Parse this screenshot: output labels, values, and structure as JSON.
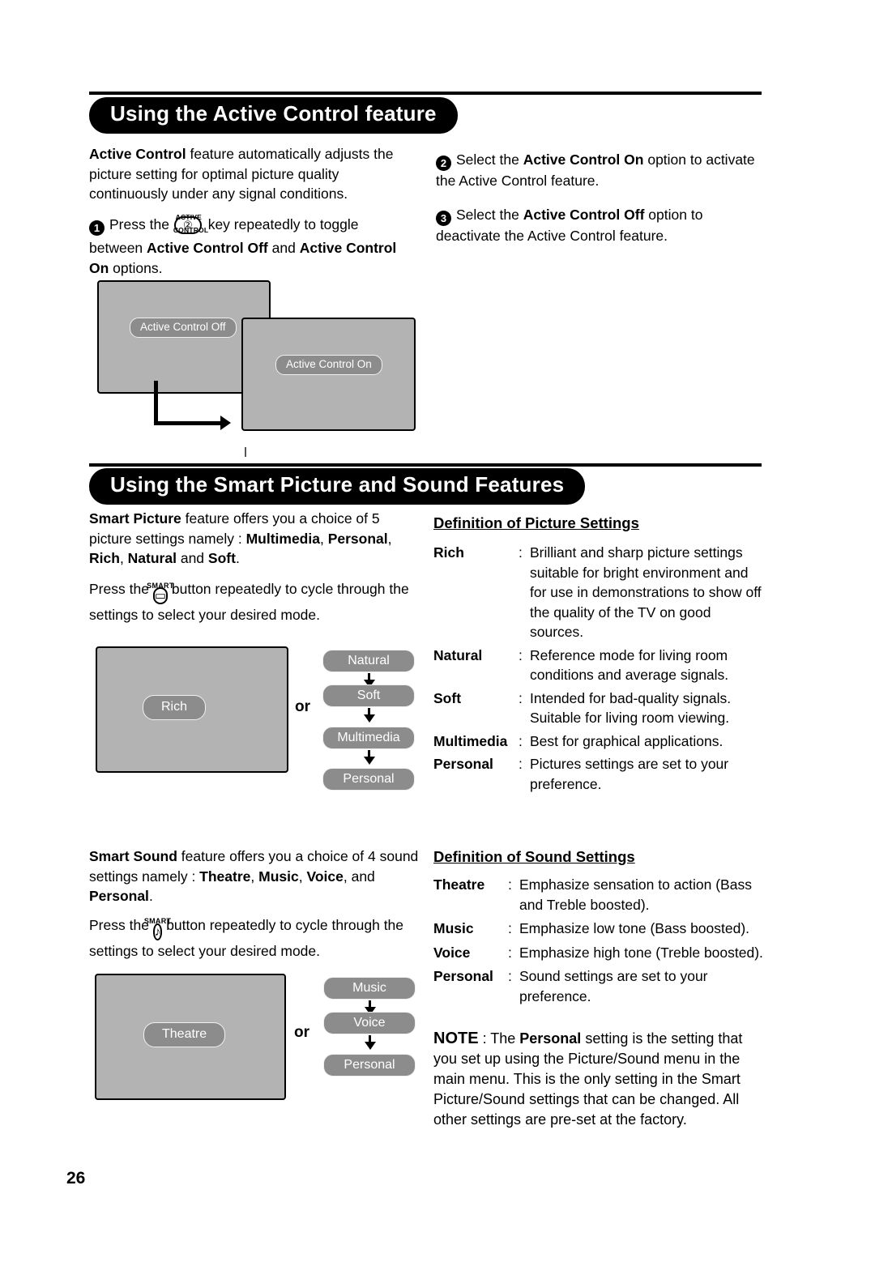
{
  "page": {
    "number": "26"
  },
  "section1": {
    "title": "Using the Active Control feature",
    "intro": {
      "lead": "Active Control",
      "rest": " feature automatically adjusts the picture setting for optimal picture quality continuously under any signal conditions."
    },
    "step1": {
      "num": "1",
      "pre": "Press the",
      "key": {
        "label_top": "ACTIVE",
        "label_bottom": "CONTROL",
        "glyph": "②"
      },
      "mid": "key repeatedly to toggle between ",
      "bold1": "Active Control Off",
      "and": " and ",
      "bold2": "Active Control On",
      "post": " options."
    },
    "step2": {
      "num": "2",
      "pre": "Select the ",
      "bold": "Active Control On",
      "post": " option to activate the Active Control feature."
    },
    "step3": {
      "num": "3",
      "pre": "Select the ",
      "bold": "Active Control Off",
      "post": " option to deactivate the Active Control feature."
    },
    "screen1_osd": "Active Control Off",
    "screen2_osd": "Active Control On"
  },
  "section2": {
    "title": "Using the Smart Picture and Sound Features",
    "picture_intro": {
      "lead": "Smart Picture",
      "mid": " feature offers you a choice of 5 picture settings namely : ",
      "b1": "Multimedia",
      "c1": ", ",
      "b2": "Personal",
      "c2": ", ",
      "b3": "Rich",
      "c3": ", ",
      "b4": "Natural",
      "c4": " and ",
      "b5": "Soft",
      "end": "."
    },
    "picture_press": {
      "pre": "Press the",
      "key": {
        "label_top": "SMART",
        "glyph": "▭"
      },
      "post": "button repeatedly to cycle through the settings to select your desired mode."
    },
    "picture_screen_osd": "Rich",
    "picture_or": "or",
    "picture_chips": [
      "Natural",
      "Soft",
      "Multimedia",
      "Personal"
    ],
    "picture_def_heading": "Definition of Picture Settings",
    "picture_defs": [
      {
        "term": "Rich",
        "colon": ":",
        "desc": "Brilliant and sharp picture settings suitable for bright environment and for use in demonstrations to show off the quality of the TV on good sources."
      },
      {
        "term": "Natural",
        "colon": ":",
        "desc": "Reference mode for living room conditions and average signals."
      },
      {
        "term": "Soft",
        "colon": ":",
        "desc": "Intended for bad-quality signals. Suitable for living room viewing."
      },
      {
        "term": "Multimedia",
        "colon": ":",
        "desc": "Best for graphical applications."
      },
      {
        "term": "Personal",
        "colon": ":",
        "desc": "Pictures settings are set to your preference."
      }
    ],
    "sound_intro": {
      "lead": "Smart Sound",
      "mid": " feature offers you a choice of 4 sound settings namely : ",
      "b1": "Theatre",
      "c1": ", ",
      "b2": "Music",
      "c2": ", ",
      "b3": "Voice",
      "c3": ", and ",
      "b4": "Personal",
      "end": "."
    },
    "sound_press": {
      "pre": "Press the",
      "key": {
        "label_top": "SMART",
        "glyph": "♪"
      },
      "post": "button repeatedly to cycle through the settings to select your desired mode."
    },
    "sound_screen_osd": "Theatre",
    "sound_or": "or",
    "sound_chips": [
      "Music",
      "Voice",
      "Personal"
    ],
    "sound_def_heading": "Definition of Sound Settings",
    "sound_defs": [
      {
        "term": "Theatre",
        "colon": ":",
        "desc": "Emphasize sensation to action (Bass and Treble boosted)."
      },
      {
        "term": "Music",
        "colon": ":",
        "desc": "Emphasize low tone (Bass boosted)."
      },
      {
        "term": "Voice",
        "colon": ":",
        "desc": "Emphasize high tone (Treble boosted)."
      },
      {
        "term": "Personal",
        "colon": ":",
        "desc": "Sound settings are set to your preference."
      }
    ],
    "note": {
      "label": "NOTE",
      "pre": " : The ",
      "bold": "Personal",
      "post": " setting is the setting that you set up using the Picture/Sound menu in the main menu. This is the only setting in the Smart Picture/Sound settings that can be changed. All other settings are pre-set at the factory."
    }
  }
}
